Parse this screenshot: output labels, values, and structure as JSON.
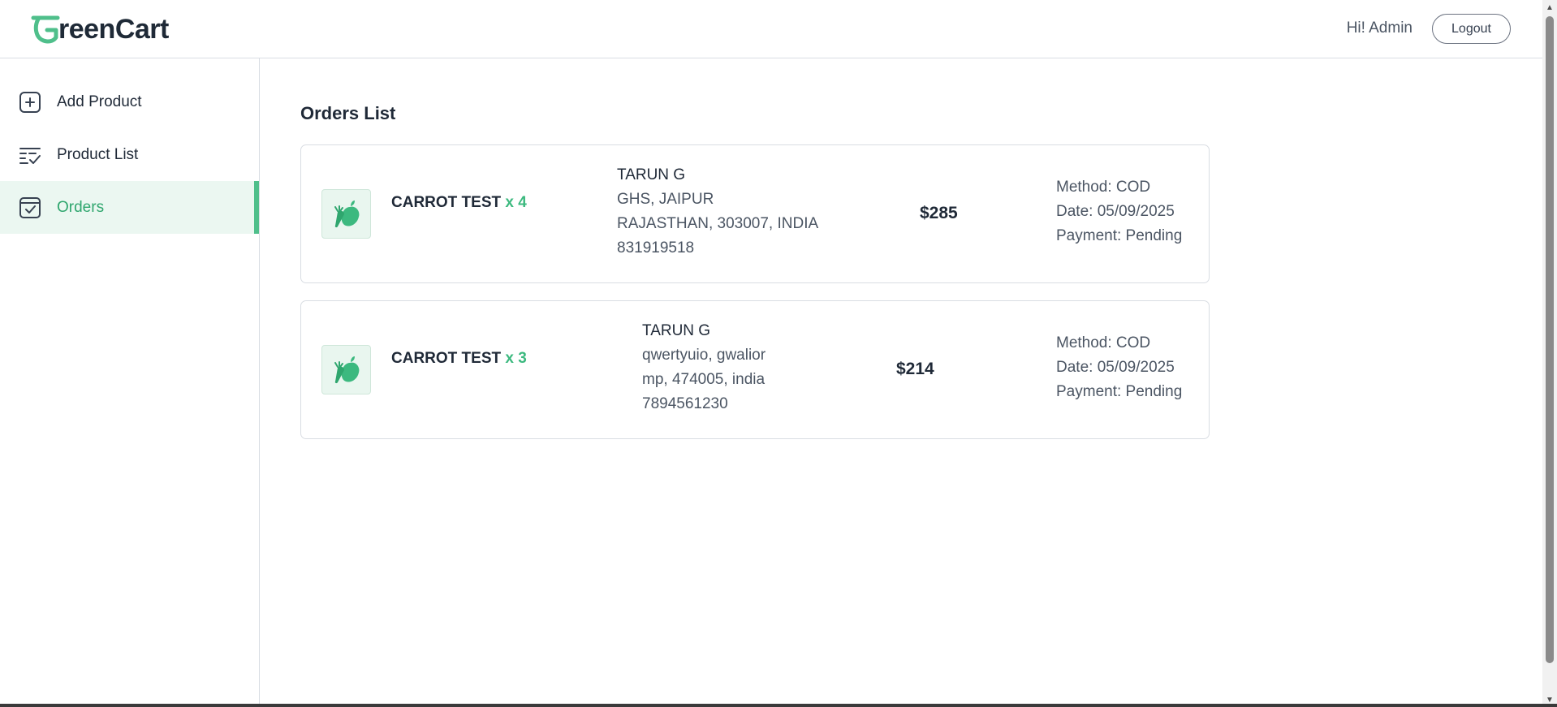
{
  "brand": {
    "name_rest": "reenCart",
    "accent": "#4fbf8b"
  },
  "header": {
    "greeting": "Hi! Admin",
    "logout_label": "Logout"
  },
  "sidebar": {
    "items": [
      {
        "label": "Add Product",
        "icon": "add-square-icon",
        "active": false
      },
      {
        "label": "Product List",
        "icon": "list-check-icon",
        "active": false
      },
      {
        "label": "Orders",
        "icon": "box-check-icon",
        "active": true
      }
    ]
  },
  "main": {
    "title": "Orders List",
    "orders": [
      {
        "product": "CARROT TEST",
        "qty": "x 4",
        "customer": "TARUN G",
        "address_line1": "GHS, JAIPUR",
        "address_line2": "RAJASTHAN, 303007, INDIA",
        "phone": "831919518",
        "amount": "$285",
        "method": "Method: COD",
        "date": "Date: 05/09/2025",
        "payment": "Payment: Pending"
      },
      {
        "product": "CARROT TEST",
        "qty": "x 3",
        "customer": "TARUN G",
        "address_line1": "qwertyuio, gwalior",
        "address_line2": "mp, 474005, india",
        "phone": "7894561230",
        "amount": "$214",
        "method": "Method: COD",
        "date": "Date: 05/09/2025",
        "payment": "Payment: Pending"
      }
    ]
  }
}
